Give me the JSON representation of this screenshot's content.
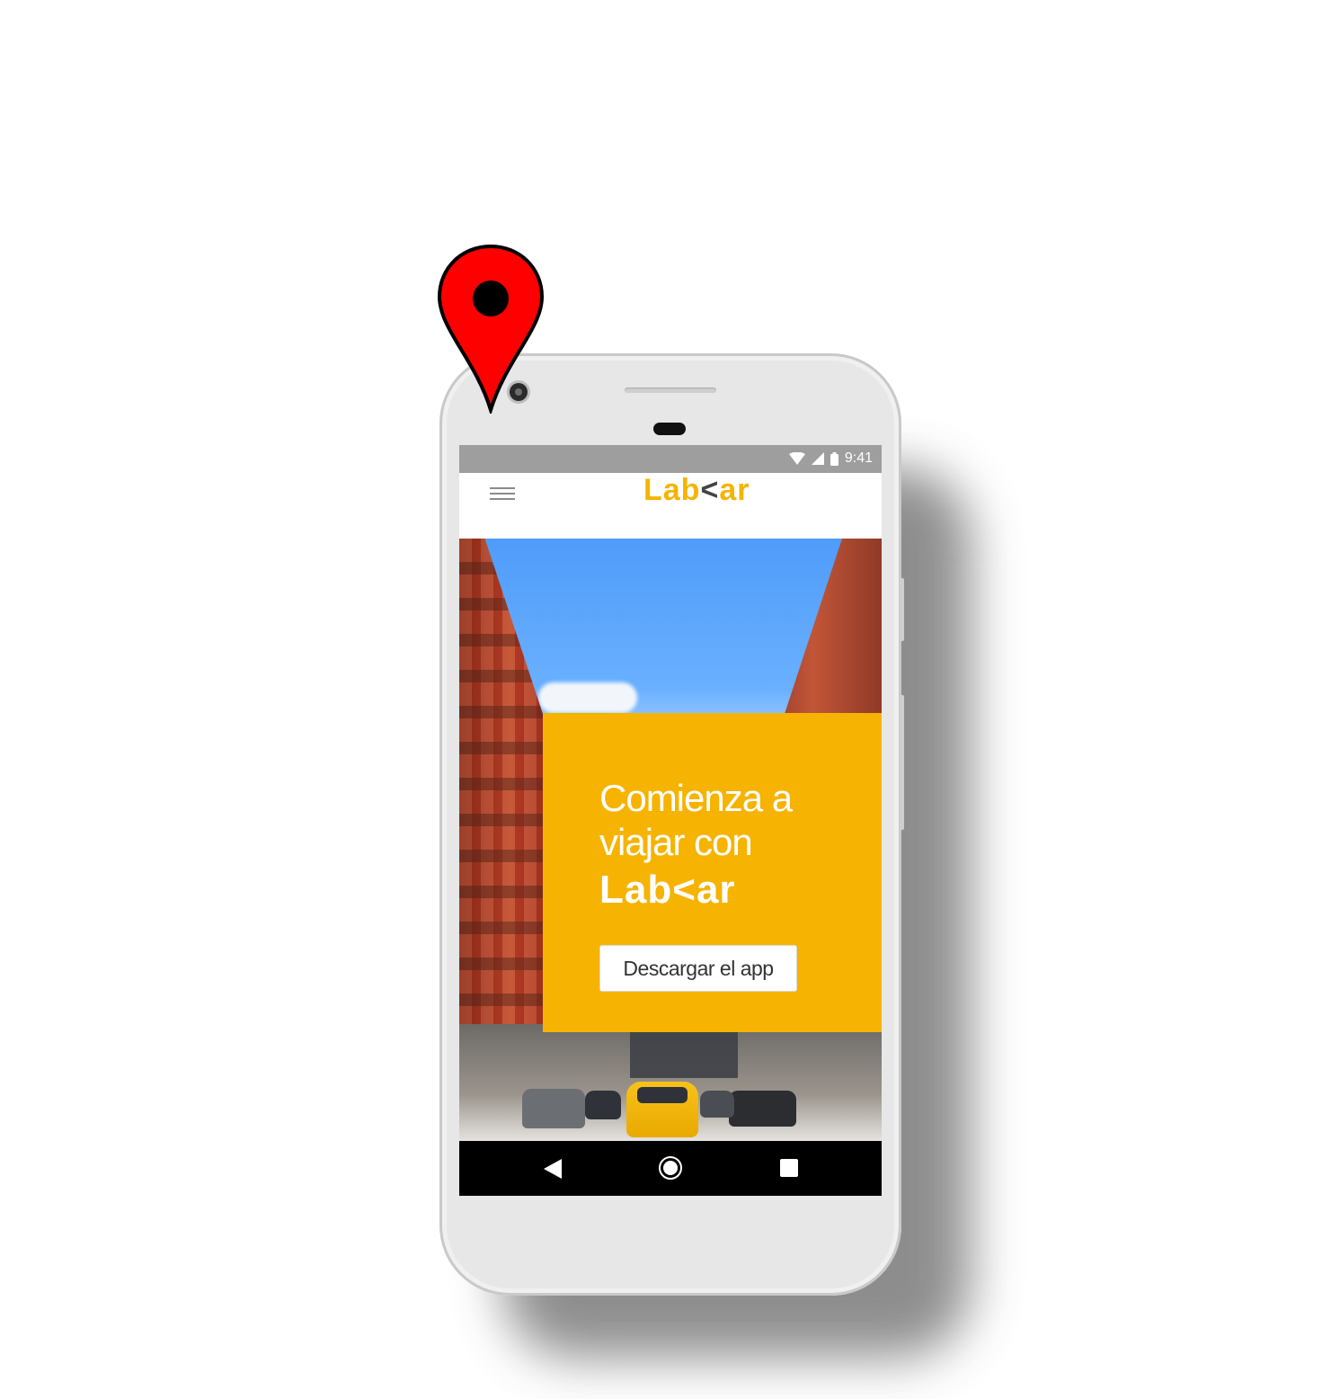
{
  "status_bar": {
    "time": "9:41",
    "icons": [
      "wifi-icon",
      "signal-icon",
      "battery-icon"
    ],
    "background": "#9e9e9e"
  },
  "app_bar": {
    "logo_prefix": "Lab",
    "logo_chevron": "<",
    "logo_suffix": "ar",
    "menu_icon": "hamburger-menu-icon",
    "brand_color": "#f6b400"
  },
  "hero": {
    "title": "Comienza a viajar con",
    "brand_prefix": "Lab",
    "brand_chevron": "<",
    "brand_suffix": "ar",
    "button_label": "Descargar el app",
    "panel_color": "#f6b301"
  },
  "nav_bar": {
    "icons": [
      "back-icon",
      "home-icon",
      "recent-apps-icon"
    ]
  },
  "decoration": {
    "pin_icon": "map-pin-icon",
    "pin_color": "#ff0000"
  }
}
